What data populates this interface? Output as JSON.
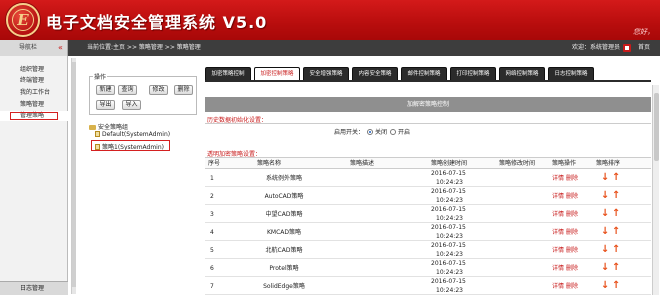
{
  "header": {
    "title": "电子文档安全管理系统 V5.0",
    "logo_letter": "E",
    "greeting": "您好，"
  },
  "subbar": {
    "nav_title": "导航栏",
    "breadcrumb": "当前位置:主页 >> 策略管理 >> 策略管理",
    "welcome": "欢迎：系统管理员",
    "home": "首页"
  },
  "sidebar": {
    "items": [
      {
        "label": "组织管理"
      },
      {
        "label": "终端管理"
      },
      {
        "label": "我的工作台"
      },
      {
        "label": "策略管理"
      },
      {
        "label": "管理策略"
      }
    ],
    "bottom": "日志管理"
  },
  "operations": {
    "legend": "操作",
    "buttons": [
      "新建",
      "查询",
      "修改",
      "删除",
      "导出",
      "导入"
    ]
  },
  "tree": {
    "root": "安全策略组",
    "nodes": [
      "Default(SystemAdmin)",
      "策略1(SystemAdmin)"
    ]
  },
  "tabs": [
    "加密策略控制",
    "加密控制策略",
    "安全增强策略",
    "内容安全策略",
    "邮件控制策略",
    "打印控制策略",
    "网络控制策略",
    "日志控制策略"
  ],
  "section": {
    "title": "加解密策略控制",
    "history_label": "历史数据初始化设置：",
    "toggle_label": "启用开关：",
    "on": "关闭",
    "off": "开启",
    "policy_label": "透明加密策略设置："
  },
  "table": {
    "columns": [
      "序号",
      "策略名称",
      "策略描述",
      "策略创建时间",
      "策略修改时间",
      "策略操作",
      "策略排序"
    ],
    "detail": "详情",
    "delete": "删除",
    "rows": [
      {
        "no": "1",
        "name": "系统例外策略",
        "date": "2016-07-15",
        "time": "10:24:23"
      },
      {
        "no": "2",
        "name": "AutoCAD策略",
        "date": "2016-07-15",
        "time": "10:24:23"
      },
      {
        "no": "3",
        "name": "中望CAD策略",
        "date": "2016-07-15",
        "time": "10:24:23"
      },
      {
        "no": "4",
        "name": "KMCAD策略",
        "date": "2016-07-15",
        "time": "10:24:23"
      },
      {
        "no": "5",
        "name": "北航CAD策略",
        "date": "2016-07-15",
        "time": "10:24:23"
      },
      {
        "no": "6",
        "name": "Protel策略",
        "date": "2016-07-15",
        "time": "10:24:23"
      },
      {
        "no": "7",
        "name": "SolidEdge策略",
        "date": "2016-07-15",
        "time": "10:24:23"
      }
    ]
  },
  "colors": {
    "brand_red": "#c81a1a",
    "dark_bar": "#3d3d3d",
    "arrow_orange": "#e8501a"
  }
}
